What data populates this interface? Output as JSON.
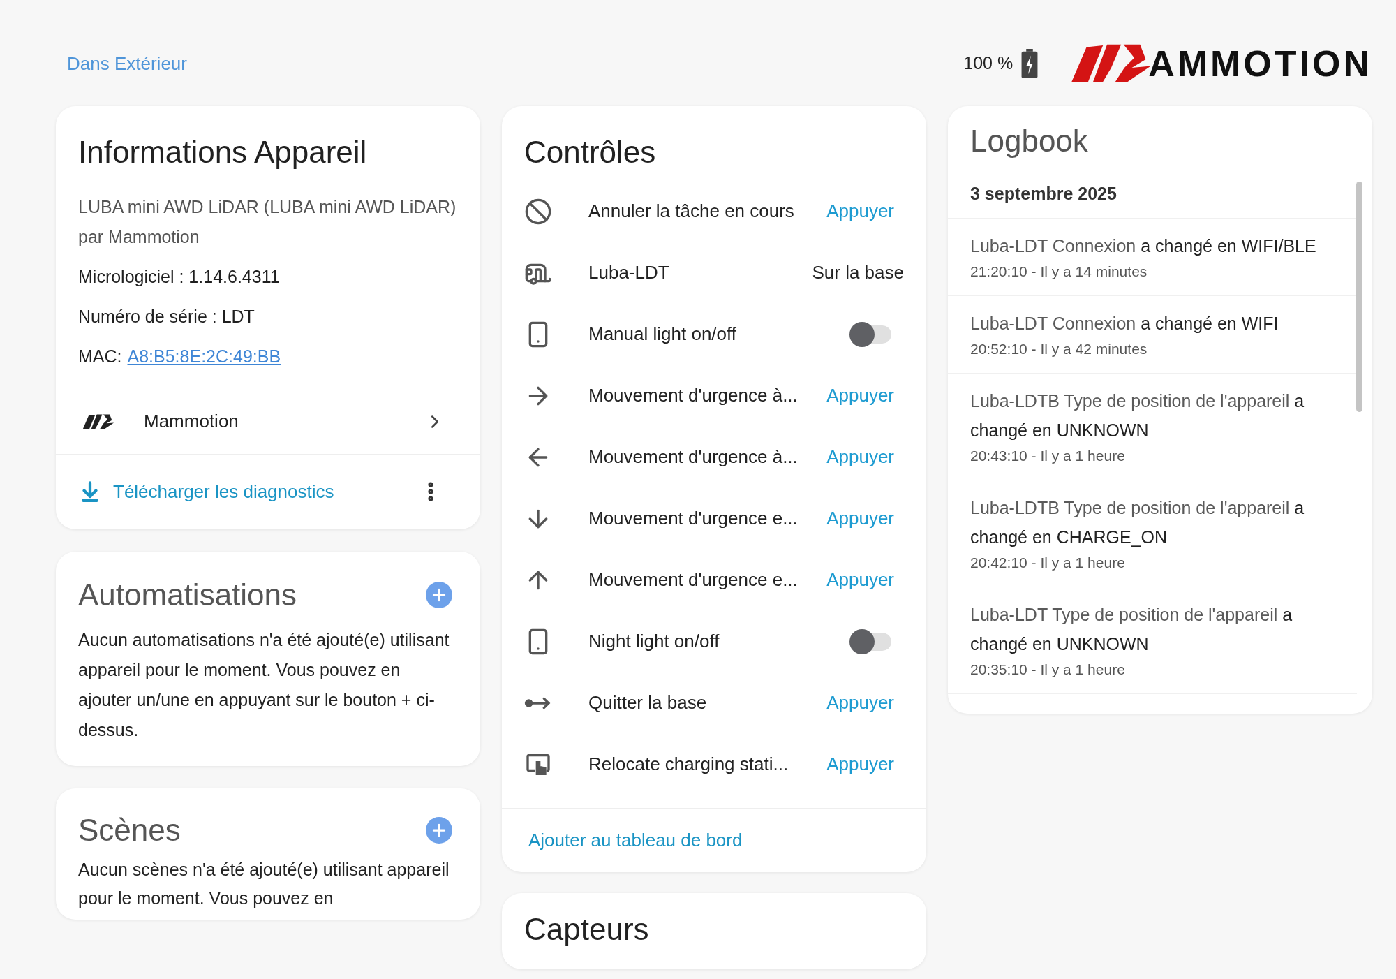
{
  "header": {
    "area_link": "Dans Extérieur",
    "battery": "100 %",
    "logo_text": "AMMOTION"
  },
  "device_info": {
    "title": "Informations Appareil",
    "model": "LUBA mini AWD LiDAR (LUBA mini AWD LiDAR)",
    "manufacturer": "par Mammotion",
    "firmware": "Micrologiciel : 1.14.6.4311",
    "serial": "Numéro de série : LDT",
    "mac_label": "MAC:",
    "mac_value": "A8:B5:8E:2C:49:BB",
    "integration": "Mammotion",
    "download": "Télécharger les diagnostics"
  },
  "automations": {
    "title": "Automatisations",
    "text": "Aucun automatisations n'a été ajouté(e) utilisant appareil pour le moment. Vous pouvez en ajouter un/une en appuyant sur le bouton + ci-dessus."
  },
  "scenes": {
    "title": "Scènes",
    "text": "Aucun scènes n'a été ajouté(e) utilisant appareil pour le moment. Vous pouvez en"
  },
  "controls": {
    "title": "Contrôles",
    "rows": [
      {
        "kind": "button",
        "name": "Annuler la tâche en cours",
        "action": "Appuyer"
      },
      {
        "kind": "state",
        "name": "Luba-LDT",
        "value": "Sur la base"
      },
      {
        "kind": "toggle",
        "name": "Manual light on/off",
        "on": false
      },
      {
        "kind": "button",
        "name": "Mouvement d'urgence à...",
        "action": "Appuyer"
      },
      {
        "kind": "button",
        "name": "Mouvement d'urgence à...",
        "action": "Appuyer"
      },
      {
        "kind": "button",
        "name": "Mouvement d'urgence e...",
        "action": "Appuyer"
      },
      {
        "kind": "button",
        "name": "Mouvement d'urgence e...",
        "action": "Appuyer"
      },
      {
        "kind": "toggle",
        "name": "Night light on/off",
        "on": false
      },
      {
        "kind": "button",
        "name": "Quitter la base",
        "action": "Appuyer"
      },
      {
        "kind": "button",
        "name": "Relocate charging stati...",
        "action": "Appuyer"
      }
    ],
    "footer_link": "Ajouter au tableau de bord"
  },
  "sensors": {
    "title": "Capteurs"
  },
  "logbook": {
    "title": "Logbook",
    "date": "3 septembre 2025",
    "entries": [
      {
        "entity": "Luba-LDT Connexion",
        "message": "a changé en WIFI/BLE",
        "time": "21:20:10 - Il y a 14 minutes"
      },
      {
        "entity": "Luba-LDT Connexion",
        "message": "a changé en WIFI",
        "time": "20:52:10 - Il y a 42 minutes"
      },
      {
        "entity": "Luba-LDTB Type de position de l'appareil",
        "message": "a changé en UNKNOWN",
        "time": "20:43:10 - Il y a 1 heure"
      },
      {
        "entity": "Luba-LDTB Type de position de l'appareil",
        "message": "a changé en CHARGE_ON",
        "time": "20:42:10 - Il y a 1 heure"
      },
      {
        "entity": "Luba-LDT Type de position de l'appareil",
        "message": "a changé en UNKNOWN",
        "time": "20:35:10 - Il y a 1 heure"
      }
    ]
  }
}
